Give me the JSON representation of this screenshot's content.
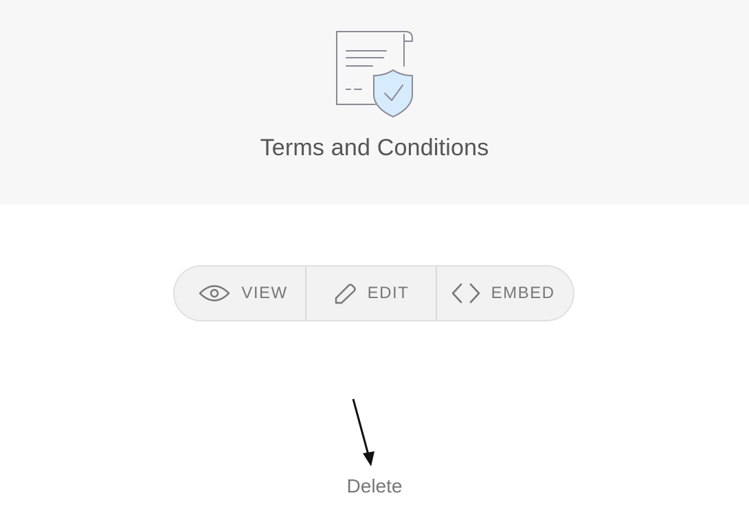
{
  "header": {
    "illustration": "document-with-shield-icon",
    "title": "Terms and Conditions"
  },
  "actions": [
    {
      "label": "VIEW",
      "icon": "eye-icon"
    },
    {
      "label": "EDIT",
      "icon": "pencil-icon"
    },
    {
      "label": "EMBED",
      "icon": "code-brackets-icon"
    }
  ],
  "delete_label": "Delete",
  "colors": {
    "header_bg": "#f7f7f7",
    "button_bg": "#f2f2f2",
    "text": "#777777",
    "title": "#555555",
    "shield_fill": "#d6ebfb"
  }
}
